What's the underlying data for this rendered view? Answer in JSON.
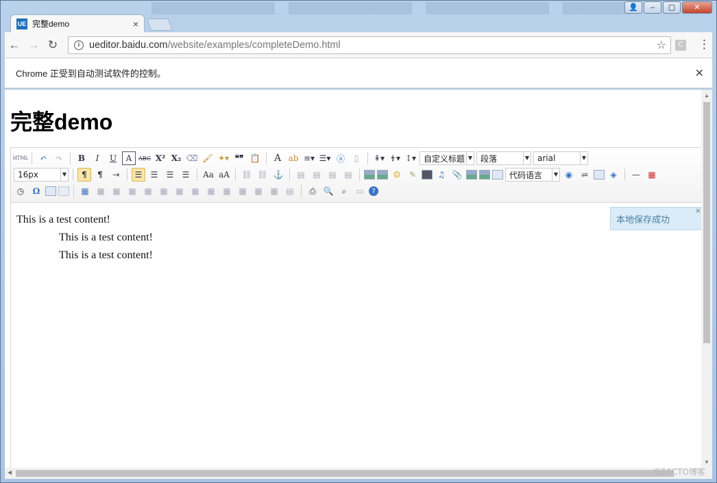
{
  "window": {
    "user_btn": "👤",
    "minimize": "–",
    "maximize": "▢",
    "close": "✕"
  },
  "tab": {
    "favicon_text": "UE",
    "title": "完整demo",
    "close": "×"
  },
  "toolbar": {
    "back": "←",
    "forward": "→",
    "reload": "↻",
    "url_host": "ueditor.baidu.com",
    "url_path": "/website/examples/completeDemo.html",
    "info_icon": "i",
    "star": "☆",
    "extension": "C",
    "menu": "⋮"
  },
  "infobar": {
    "message": "Chrome 正受到自动测试软件的控制。",
    "close": "✕"
  },
  "page": {
    "title": "完整demo"
  },
  "editor": {
    "row1": {
      "html": "HTML",
      "bold": "B",
      "italic": "I",
      "underline": "U",
      "fontborder": "A",
      "strike": "ABC",
      "superscript": "X²",
      "subscript": "X₂",
      "quote": "❝❞",
      "forecolor": "A",
      "backcolor": "ab",
      "custom_heading": "自定义标题",
      "paragraph": "段落",
      "font_family": "arial"
    },
    "row2": {
      "font_size": "16px",
      "ltr": "¶",
      "rtl": "¶",
      "code_lang": "代码语言"
    },
    "row3": {
      "special_char": "Ω",
      "help": "?"
    },
    "content": [
      "This is a test content!",
      "This is a test content!",
      "This is a test content!"
    ],
    "toast": "本地保存成功",
    "toast_close": "×"
  },
  "watermark": "@51CTO博客"
}
